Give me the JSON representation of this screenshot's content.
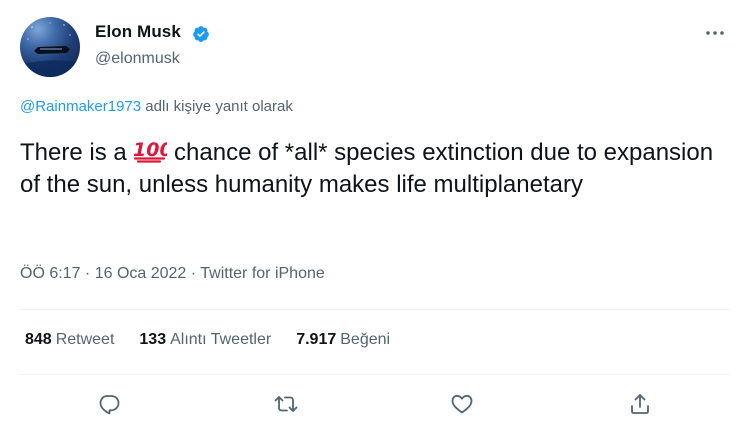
{
  "author": {
    "display_name": "Elon Musk",
    "handle": "@elonmusk",
    "verified": true,
    "verified_color": "#1d9bf0"
  },
  "reply_context": {
    "mention": "@Rainmaker1973",
    "suffix": " adlı kişiye yanıt olarak"
  },
  "tweet": {
    "text_before_emoji": "There is a ",
    "emoji": "hundred-points-emoji",
    "text_after_emoji": " chance of *all* species extinction due to expansion of the sun, unless humanity makes life multiplanetary"
  },
  "meta": {
    "time": "ÖÖ 6:17",
    "separator": " · ",
    "date": "16 Oca 2022",
    "source": "Twitter for iPhone"
  },
  "stats": [
    {
      "count": "848",
      "label": "Retweet"
    },
    {
      "count": "133",
      "label": "Alıntı Tweetler"
    },
    {
      "count": "7.917",
      "label": "Beğeni"
    }
  ],
  "actions": [
    {
      "icon": "reply-icon"
    },
    {
      "icon": "retweet-icon"
    },
    {
      "icon": "like-icon"
    },
    {
      "icon": "share-icon"
    }
  ],
  "colors": {
    "text": "#0f1419",
    "secondary": "#536471",
    "accent": "#1d9bf0",
    "divider": "#eff3f4",
    "emoji_red": "#e0153a"
  }
}
